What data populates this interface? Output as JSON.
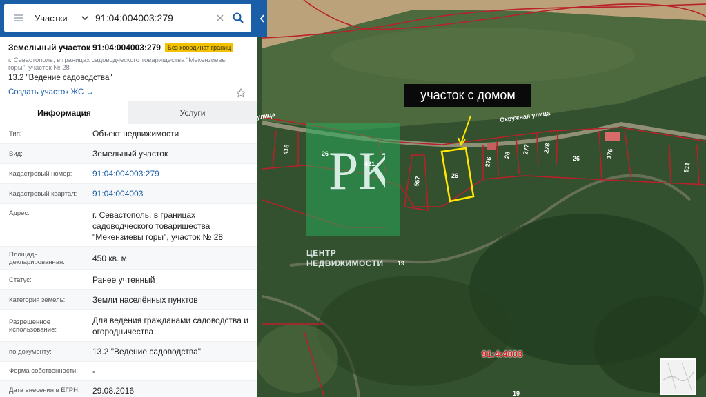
{
  "search": {
    "type_label": "Участки",
    "query": "91:04:004003:279"
  },
  "panel": {
    "title": "Земельный участок 91:04:004003:279",
    "badge": "Без координат границ",
    "address_line": "г. Севастополь, в границах садоводческого товарищества \"Мекензиевы горы\", участок № 28",
    "purpose": "13.2 \"Ведение садоводства\"",
    "create_link": "Создать участок ЖС →",
    "tabs": [
      {
        "label": "Информация"
      },
      {
        "label": "Услуги"
      }
    ],
    "rows": [
      {
        "label": "Тип:",
        "value": "Объект недвижимости"
      },
      {
        "label": "Вид:",
        "value": "Земельный участок"
      },
      {
        "label": "Кадастровый номер:",
        "value": "91:04:004003:279"
      },
      {
        "label": "Кадастровый квартал:",
        "value": "91:04:004003"
      },
      {
        "label": "Адрес:",
        "value": "г. Севастополь, в границах садоводческого товарищества \"Мекензиевы горы\", участок № 28"
      },
      {
        "label": "Площадь декларированная:",
        "value": "450 кв. м"
      },
      {
        "label": "Статус:",
        "value": "Ранее учтенный"
      },
      {
        "label": "Категория земель:",
        "value": "Земли населённых пунктов"
      },
      {
        "label": "Разрешенное использование:",
        "value": "Для ведения гражданами садоводства и огородничества"
      },
      {
        "label": "по документу:",
        "value": "13.2 \"Ведение садоводства\""
      },
      {
        "label": "Форма собственности:",
        "value": "-"
      },
      {
        "label": "Дата внесения в ЕГРН:",
        "value": "29.08.2016"
      }
    ]
  },
  "map": {
    "callout": "участок с домом",
    "watermark_logo": "РК",
    "watermark_line1": "ЦЕНТР",
    "watermark_line2": "НЕДВИЖИМОСТИ",
    "street_1": "улица",
    "street_2": "Окружная улица",
    "quarter_label": "91:4:4003",
    "parcel_labels": [
      "416",
      "26",
      "421",
      "557",
      "26",
      "276",
      "26",
      "277",
      "278",
      "26",
      "176",
      "511"
    ],
    "marker_1": "19",
    "marker_2": "19"
  },
  "colors": {
    "header_blue": "#1a5ea8",
    "badge_yellow": "#f2c200",
    "parcel_border": "#b8202a",
    "highlight": "#ffe600"
  }
}
